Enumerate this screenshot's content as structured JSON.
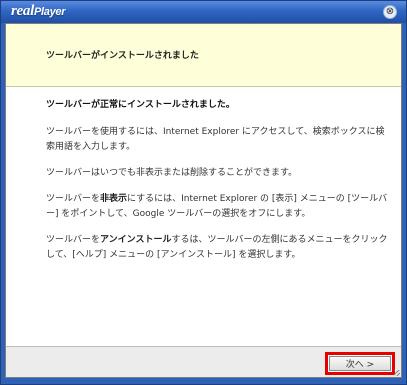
{
  "window": {
    "brand_prefix": "real",
    "brand_suffix": "Player",
    "close_glyph": "⊗"
  },
  "header": {
    "title": "ツールバーがインストールされました"
  },
  "body": {
    "headline": "ツールバーが正常にインストールされました。",
    "para1": "ツールバーを使用するには、Internet Explorer にアクセスして、検索ボックスに検索用語を入力します。",
    "para2": "ツールバーはいつでも非表示または削除することができます。",
    "para3_pre": "ツールバーを",
    "para3_bold": "非表示",
    "para3_post": "にするには、Internet Explorer の [表示] メニューの [ツールバー] をポイントして、Google ツールバーの選択をオフにします。",
    "para4_pre": "ツールバーを",
    "para4_bold": "アンインストール",
    "para4_post": "するは、ツールバーの左側にあるメニューをクリックして、[ヘルプ] メニューの [アンインストール] を選択します。"
  },
  "footer": {
    "next_label": "次へ >"
  },
  "colors": {
    "title_blue": "#2f62b4",
    "header_bg": "#fefed9",
    "highlight_red": "#e60000"
  }
}
